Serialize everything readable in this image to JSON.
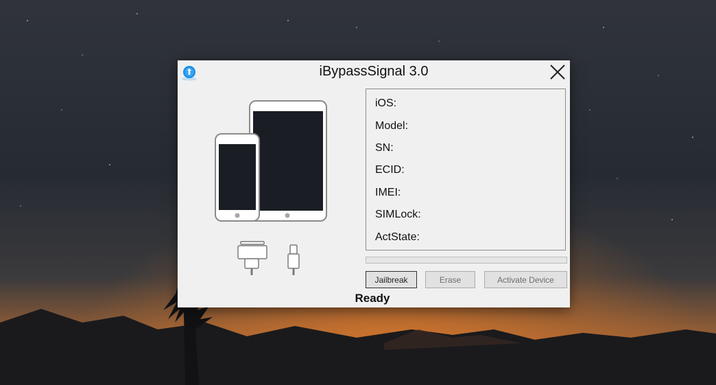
{
  "window": {
    "title": "iBypassSignal 3.0"
  },
  "device_info": {
    "rows": [
      {
        "label": "iOS:"
      },
      {
        "label": "Model:"
      },
      {
        "label": "SN:"
      },
      {
        "label": "ECID:"
      },
      {
        "label": "IMEI:"
      },
      {
        "label": "SIMLock:"
      },
      {
        "label": "ActState:"
      }
    ]
  },
  "progress": {
    "value": 0
  },
  "buttons": {
    "jailbreak": "Jailbreak",
    "erase": "Erase",
    "activate": "Activate Device"
  },
  "status": {
    "text": "Ready"
  },
  "icons": {
    "app": "app-logo-icon",
    "close": "close-icon",
    "devices": "ipad-iphone-icon",
    "connector30": "30-pin-connector-icon",
    "lightning": "lightning-connector-icon"
  },
  "colors": {
    "window_bg": "#f0f0f0",
    "app_icon_blue": "#1e8ee6",
    "device_screen": "#1a1e24"
  }
}
